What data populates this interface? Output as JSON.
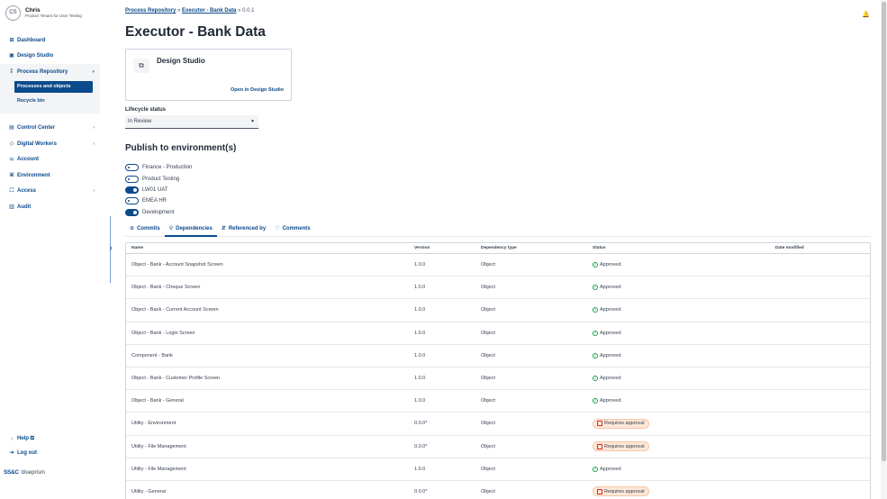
{
  "user": {
    "initials": "CS",
    "name": "Chris",
    "tenant": "Product Tenant for User Testing"
  },
  "nav": {
    "dashboard": "Dashboard",
    "design_studio": "Design Studio",
    "process_repository": "Process Repository",
    "processes_and_objects": "Processes and objects",
    "recycle_bin": "Recycle bin",
    "control_center": "Control Center",
    "digital_workers": "Digital Workers",
    "account": "Account",
    "environment": "Environment",
    "access": "Access",
    "audit": "Audit",
    "help": "Help ⧉",
    "logout": "Log out"
  },
  "brand": {
    "logo": "SS&C",
    "word": "blueprism"
  },
  "breadcrumb": {
    "root": "Process Repository",
    "parent": "Executor - Bank Data",
    "current": "0.0.1",
    "sep": "»"
  },
  "page_title": "Executor - Bank Data",
  "design_card": {
    "title": "Design Studio",
    "link": "Open in Design Studio"
  },
  "lifecycle": {
    "label": "Lifecycle status",
    "value": "In Review"
  },
  "publish": {
    "title": "Publish to environment(s)",
    "environments": [
      {
        "name": "Finance - Production",
        "on": false
      },
      {
        "name": "Product Testing",
        "on": false
      },
      {
        "name": "LW01 UAT",
        "on": true
      },
      {
        "name": "EMEA HR",
        "on": false
      },
      {
        "name": "Development",
        "on": true
      }
    ]
  },
  "tabs": {
    "commits": "Commits",
    "dependencies": "Dependencies",
    "referenced_by": "Referenced by",
    "comments": "Comments"
  },
  "table": {
    "headers": {
      "name": "Name",
      "version": "Version",
      "dependency_type": "Dependency type",
      "status": "Status",
      "date_modified": "Date modified"
    },
    "rows": [
      {
        "name": "Object - Bank - Account Snapshot Screen",
        "version": "1.0.0",
        "type": "Object",
        "status": "Approved",
        "date": ""
      },
      {
        "name": "Object - Bank - Cheque Screen",
        "version": "1.0.0",
        "type": "Object",
        "status": "Approved",
        "date": ""
      },
      {
        "name": "Object - Bank - Current Account Screen",
        "version": "1.0.0",
        "type": "Object",
        "status": "Approved",
        "date": ""
      },
      {
        "name": "Object - Bank - Login Screen",
        "version": "1.0.0",
        "type": "Object",
        "status": "Approved",
        "date": ""
      },
      {
        "name": "Component - Bank",
        "version": "1.0.0",
        "type": "Object",
        "status": "Approved",
        "date": ""
      },
      {
        "name": "Object - Bank - Customer Profile Screen",
        "version": "1.0.0",
        "type": "Object",
        "status": "Approved",
        "date": ""
      },
      {
        "name": "Object - Bank - General",
        "version": "1.0.0",
        "type": "Object",
        "status": "Approved",
        "date": ""
      },
      {
        "name": "Utility - Environment",
        "version": "0.0.0*",
        "type": "Object",
        "status": "Requires approval",
        "date": ""
      },
      {
        "name": "Utility - File Management",
        "version": "0.0.0*",
        "type": "Object",
        "status": "Requires approval",
        "date": ""
      },
      {
        "name": "Utility - File Management",
        "version": "1.0.0",
        "type": "Object",
        "status": "Approved",
        "date": ""
      },
      {
        "name": "Utility - General",
        "version": "0.0.0*",
        "type": "Object",
        "status": "Requires approval",
        "date": ""
      }
    ]
  },
  "colors": {
    "accent": "#0b4a8b",
    "approved": "#16a34a",
    "requires_approval_bg": "#fde8d7"
  }
}
